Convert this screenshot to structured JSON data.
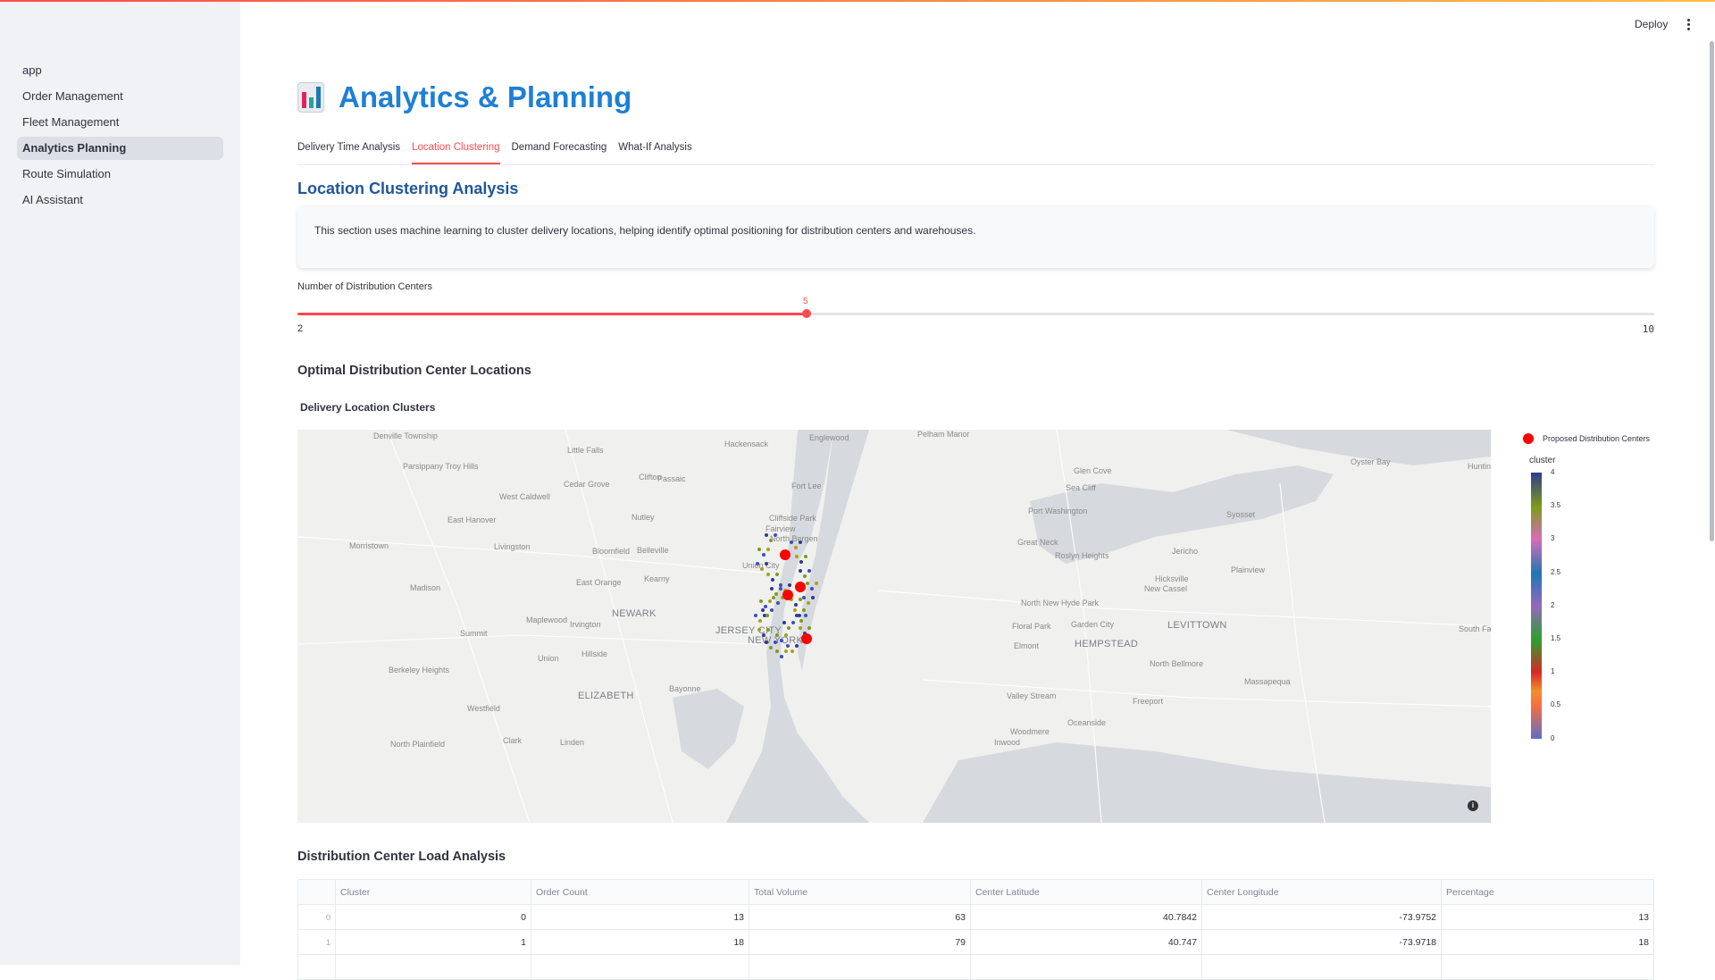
{
  "sidebar": {
    "items": [
      {
        "label": "app"
      },
      {
        "label": "Order Management"
      },
      {
        "label": "Fleet Management"
      },
      {
        "label": "Analytics Planning"
      },
      {
        "label": "Route Simulation"
      },
      {
        "label": "AI Assistant"
      }
    ],
    "active_index": 3
  },
  "header": {
    "deploy_label": "Deploy",
    "menu_icon": "kebab-menu-icon"
  },
  "page": {
    "title": "Analytics & Planning",
    "title_icon": "bar-chart-emoji-icon",
    "tabs": [
      {
        "label": "Delivery Time Analysis"
      },
      {
        "label": "Location Clustering"
      },
      {
        "label": "Demand Forecasting"
      },
      {
        "label": "What-If Analysis"
      }
    ],
    "active_tab": 1,
    "section_title": "Location Clustering Analysis",
    "info_text": "This section uses machine learning to cluster delivery locations, helping identify optimal positioning for distribution centers and warehouses.",
    "slider": {
      "label": "Number of Distribution Centers",
      "value": 5,
      "min": 2,
      "max": 10,
      "value_text": "5",
      "min_text": "2",
      "max_text": "10"
    },
    "optimal_heading": "Optimal Distribution Center Locations",
    "map_title": "Delivery Location Clusters",
    "load_heading": "Distribution Center Load Analysis"
  },
  "map": {
    "place_labels": [
      "Denville Township",
      "Little Falls",
      "Hackensack",
      "Englewood",
      "Pelham Manor",
      "Parsippany Troy Hills",
      "Clifton",
      "Passaic",
      "Cedar Grove",
      "West Caldwell",
      "Fort Lee",
      "Glen Cove",
      "Sea Cliff",
      "Oyster Bay",
      "Huntington",
      "East Hanover",
      "Nutley",
      "Cliffside Park",
      "Fairview",
      "North Bergen",
      "Port Washington",
      "Syosset",
      "Morristown",
      "Livingston",
      "Bloomfield",
      "Belleville",
      "Union City",
      "Great Neck",
      "Roslyn Heights",
      "Jericho",
      "Plainview",
      "Madison",
      "East Orange",
      "Kearny",
      "Hicksville",
      "New Cassel",
      "Newark",
      "Maplewood",
      "Irvington",
      "North New Hyde Park",
      "Floral Park",
      "Garden City",
      "Levittown",
      "South Farmingdale",
      "Summit",
      "Jersey City",
      "New York",
      "Elmont",
      "Hempstead",
      "Hillside",
      "Union",
      "Berkeley Heights",
      "North Bellmore",
      "Elizabeth",
      "Bayonne",
      "Massapequa",
      "Westfield",
      "Valley Stream",
      "Freeport",
      "Oceanside",
      "Woodmere",
      "North Plainfield",
      "Clark",
      "Linden",
      "Inwood"
    ],
    "info_icon": "info-icon",
    "legend": {
      "centers_label": "Proposed Distribution Centers",
      "colorbar_title": "cluster",
      "ticks": [
        "4",
        "3.5",
        "3",
        "2.5",
        "2",
        "1.5",
        "1",
        "0.5",
        "0"
      ]
    }
  },
  "chart_data": {
    "type": "scatter",
    "title": "Delivery Location Clusters",
    "series": [
      {
        "name": "Proposed Distribution Centers",
        "points": [
          {
            "lat": 40.7842,
            "lon": -73.9752,
            "cluster": 0
          },
          {
            "lat": 40.747,
            "lon": -73.9718,
            "cluster": 1
          }
        ]
      }
    ],
    "colorbar": {
      "title": "cluster",
      "range": [
        0,
        4
      ]
    }
  },
  "table": {
    "columns": [
      "",
      "Cluster",
      "Order Count",
      "Total Volume",
      "Center Latitude",
      "Center Longitude",
      "Percentage"
    ],
    "rows": [
      [
        "0",
        "0",
        "13",
        "63",
        "40.7842",
        "-73.9752",
        "13"
      ],
      [
        "1",
        "1",
        "18",
        "79",
        "40.747",
        "-73.9718",
        "18"
      ]
    ]
  }
}
